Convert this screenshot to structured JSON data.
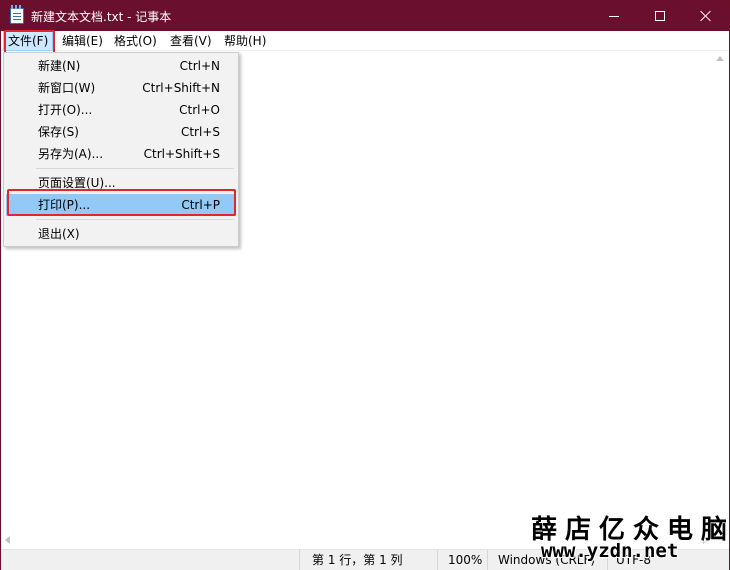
{
  "window": {
    "title": "新建文本文档.txt - 记事本",
    "accent_color": "#6b0f2e"
  },
  "menubar": {
    "file": "文件(F)",
    "edit": "编辑(E)",
    "format": "格式(O)",
    "view": "查看(V)",
    "help": "帮助(H)"
  },
  "file_menu": {
    "items": [
      {
        "label": "新建(N)",
        "shortcut": "Ctrl+N"
      },
      {
        "label": "新窗口(W)",
        "shortcut": "Ctrl+Shift+N"
      },
      {
        "label": "打开(O)...",
        "shortcut": "Ctrl+O"
      },
      {
        "label": "保存(S)",
        "shortcut": "Ctrl+S"
      },
      {
        "label": "另存为(A)...",
        "shortcut": "Ctrl+Shift+S"
      },
      {
        "label": "页面设置(U)...",
        "shortcut": ""
      },
      {
        "label": "打印(P)...",
        "shortcut": "Ctrl+P"
      },
      {
        "label": "退出(X)",
        "shortcut": ""
      }
    ],
    "highlighted_item": "打印(P)..."
  },
  "editor": {
    "content": ""
  },
  "statusbar": {
    "position": "第 1 行，第 1 列",
    "zoom": "100%",
    "line_ending": "Windows (CRLF)",
    "encoding": "UTF-8"
  },
  "watermark": {
    "name": "薛店亿众电脑",
    "url": "www.yzdn.net"
  },
  "icons": {
    "app": "notepad-icon",
    "minimize": "minimize-icon",
    "maximize": "maximize-icon",
    "close": "close-icon"
  }
}
